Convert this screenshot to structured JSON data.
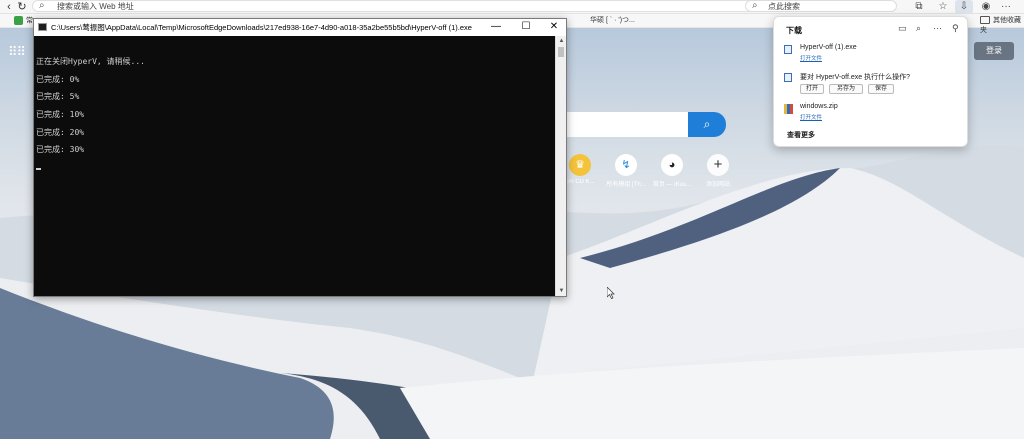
{
  "browser": {
    "address_placeholder": "搜索或输入 Web 地址",
    "search_placeholder": "点此搜索",
    "favorites": [
      {
        "label": "常"
      },
      {
        "label": "华硕 [ ` ·  ')つ..."
      },
      {
        "label": "其他收藏夹"
      }
    ]
  },
  "page": {
    "login_label": "登录",
    "search_button_icon": "search-icon",
    "quick_links": [
      {
        "label": "om CD K..."
      },
      {
        "label": "所有模组 [Th..."
      },
      {
        "label": "首页 — iKuu..."
      },
      {
        "label": "添加网站"
      }
    ]
  },
  "console": {
    "title": "C:\\Users\\莺振图\\AppData\\Local\\Temp\\MicrosoftEdgeDownloads\\217ed938-16e7-4d90-a018-35a2be55b5bd\\HyperV-off (1).exe",
    "minimize": "—",
    "maximize": "☐",
    "close": "✕",
    "lines": [
      "正在关闭HyperV, 请稍候...",
      "已完成: 0%",
      "已完成: 5%",
      "已完成: 10%",
      "已完成: 20%",
      "已完成: 30%"
    ],
    "progress_percent": 30
  },
  "downloads": {
    "header": "下载",
    "items": [
      {
        "name": "HyperV-off (1).exe",
        "sub": "打开文件"
      },
      {
        "name": "要对 HyperV-off.exe 执行什么操作?",
        "buttons": [
          "打开",
          "另存为",
          "保存"
        ]
      },
      {
        "name": "windows.zip",
        "sub": "打开文件"
      }
    ],
    "see_more": "查看更多"
  }
}
